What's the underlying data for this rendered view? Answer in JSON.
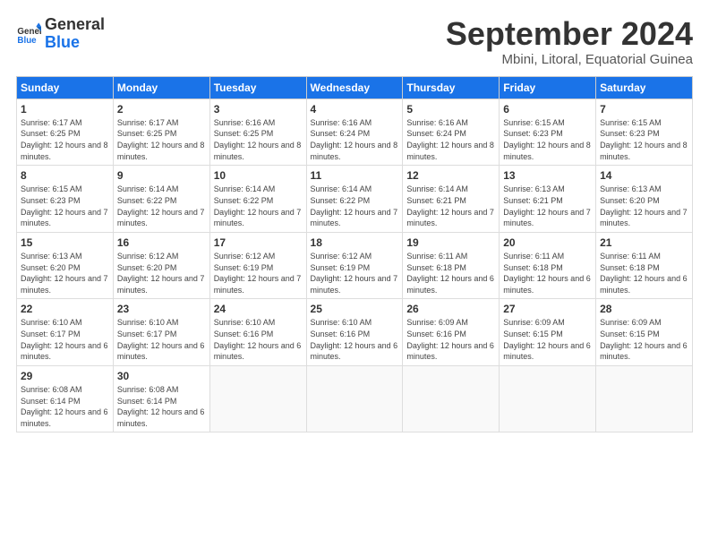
{
  "logo": {
    "line1": "General",
    "line2": "Blue"
  },
  "title": "September 2024",
  "subtitle": "Mbini, Litoral, Equatorial Guinea",
  "days_header": [
    "Sunday",
    "Monday",
    "Tuesday",
    "Wednesday",
    "Thursday",
    "Friday",
    "Saturday"
  ],
  "weeks": [
    [
      {
        "num": "1",
        "rise": "6:17 AM",
        "set": "6:25 PM",
        "daylight": "12 hours and 8 minutes."
      },
      {
        "num": "2",
        "rise": "6:17 AM",
        "set": "6:25 PM",
        "daylight": "12 hours and 8 minutes."
      },
      {
        "num": "3",
        "rise": "6:16 AM",
        "set": "6:25 PM",
        "daylight": "12 hours and 8 minutes."
      },
      {
        "num": "4",
        "rise": "6:16 AM",
        "set": "6:24 PM",
        "daylight": "12 hours and 8 minutes."
      },
      {
        "num": "5",
        "rise": "6:16 AM",
        "set": "6:24 PM",
        "daylight": "12 hours and 8 minutes."
      },
      {
        "num": "6",
        "rise": "6:15 AM",
        "set": "6:23 PM",
        "daylight": "12 hours and 8 minutes."
      },
      {
        "num": "7",
        "rise": "6:15 AM",
        "set": "6:23 PM",
        "daylight": "12 hours and 8 minutes."
      }
    ],
    [
      {
        "num": "8",
        "rise": "6:15 AM",
        "set": "6:23 PM",
        "daylight": "12 hours and 7 minutes."
      },
      {
        "num": "9",
        "rise": "6:14 AM",
        "set": "6:22 PM",
        "daylight": "12 hours and 7 minutes."
      },
      {
        "num": "10",
        "rise": "6:14 AM",
        "set": "6:22 PM",
        "daylight": "12 hours and 7 minutes."
      },
      {
        "num": "11",
        "rise": "6:14 AM",
        "set": "6:22 PM",
        "daylight": "12 hours and 7 minutes."
      },
      {
        "num": "12",
        "rise": "6:14 AM",
        "set": "6:21 PM",
        "daylight": "12 hours and 7 minutes."
      },
      {
        "num": "13",
        "rise": "6:13 AM",
        "set": "6:21 PM",
        "daylight": "12 hours and 7 minutes."
      },
      {
        "num": "14",
        "rise": "6:13 AM",
        "set": "6:20 PM",
        "daylight": "12 hours and 7 minutes."
      }
    ],
    [
      {
        "num": "15",
        "rise": "6:13 AM",
        "set": "6:20 PM",
        "daylight": "12 hours and 7 minutes."
      },
      {
        "num": "16",
        "rise": "6:12 AM",
        "set": "6:20 PM",
        "daylight": "12 hours and 7 minutes."
      },
      {
        "num": "17",
        "rise": "6:12 AM",
        "set": "6:19 PM",
        "daylight": "12 hours and 7 minutes."
      },
      {
        "num": "18",
        "rise": "6:12 AM",
        "set": "6:19 PM",
        "daylight": "12 hours and 7 minutes."
      },
      {
        "num": "19",
        "rise": "6:11 AM",
        "set": "6:18 PM",
        "daylight": "12 hours and 6 minutes."
      },
      {
        "num": "20",
        "rise": "6:11 AM",
        "set": "6:18 PM",
        "daylight": "12 hours and 6 minutes."
      },
      {
        "num": "21",
        "rise": "6:11 AM",
        "set": "6:18 PM",
        "daylight": "12 hours and 6 minutes."
      }
    ],
    [
      {
        "num": "22",
        "rise": "6:10 AM",
        "set": "6:17 PM",
        "daylight": "12 hours and 6 minutes."
      },
      {
        "num": "23",
        "rise": "6:10 AM",
        "set": "6:17 PM",
        "daylight": "12 hours and 6 minutes."
      },
      {
        "num": "24",
        "rise": "6:10 AM",
        "set": "6:16 PM",
        "daylight": "12 hours and 6 minutes."
      },
      {
        "num": "25",
        "rise": "6:10 AM",
        "set": "6:16 PM",
        "daylight": "12 hours and 6 minutes."
      },
      {
        "num": "26",
        "rise": "6:09 AM",
        "set": "6:16 PM",
        "daylight": "12 hours and 6 minutes."
      },
      {
        "num": "27",
        "rise": "6:09 AM",
        "set": "6:15 PM",
        "daylight": "12 hours and 6 minutes."
      },
      {
        "num": "28",
        "rise": "6:09 AM",
        "set": "6:15 PM",
        "daylight": "12 hours and 6 minutes."
      }
    ],
    [
      {
        "num": "29",
        "rise": "6:08 AM",
        "set": "6:14 PM",
        "daylight": "12 hours and 6 minutes."
      },
      {
        "num": "30",
        "rise": "6:08 AM",
        "set": "6:14 PM",
        "daylight": "12 hours and 6 minutes."
      },
      null,
      null,
      null,
      null,
      null
    ]
  ]
}
